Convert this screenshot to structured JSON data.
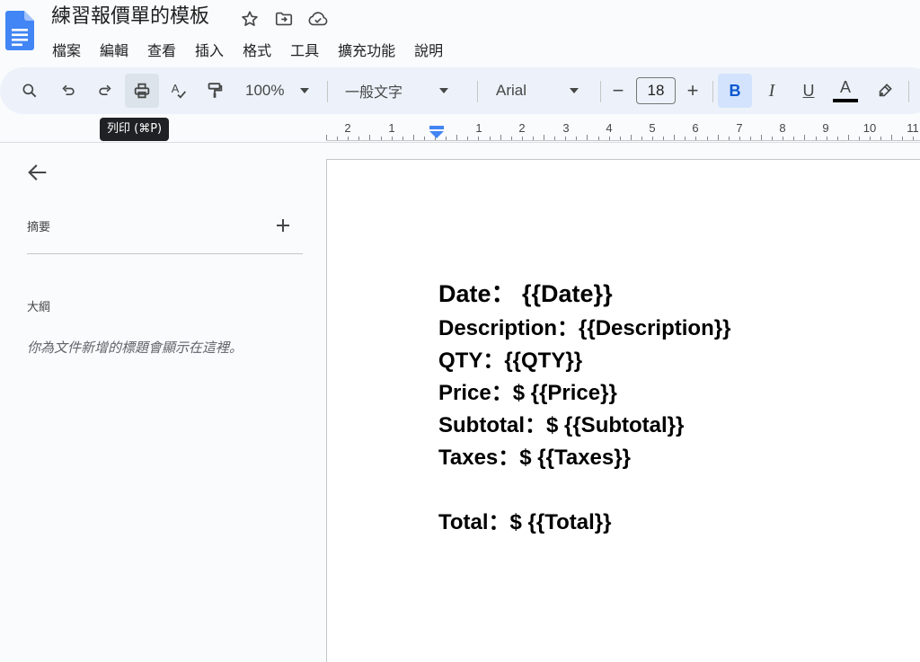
{
  "document": {
    "title": "練習報價單的模板"
  },
  "menu": {
    "items": [
      "檔案",
      "編輯",
      "查看",
      "插入",
      "格式",
      "工具",
      "擴充功能",
      "說明"
    ]
  },
  "toolbar": {
    "zoom": "100%",
    "paragraph_style": "一般文字",
    "font": "Arial",
    "font_size": "18",
    "bold_label": "B",
    "italic_label": "I",
    "underline_label": "U",
    "text_color_label": "A",
    "minus_label": "−",
    "plus_label": "+",
    "text_color": "#000000",
    "active_color": "#d3e3fd"
  },
  "tooltip": {
    "text": "列印 (⌘P)"
  },
  "ruler": {
    "labels": [
      "2",
      "1",
      "1",
      "2",
      "3",
      "4",
      "5",
      "6",
      "7",
      "8",
      "9",
      "10",
      "11"
    ]
  },
  "sidebar": {
    "summary_label": "摘要",
    "outline_label": "大綱",
    "outline_hint": "你為文件新增的標題會顯示在這裡。"
  },
  "content": {
    "lines": [
      "Date： {{Date}}",
      "Description：{{Description}}",
      "QTY：{{QTY}}",
      "Price：$ {{Price}}",
      "Subtotal：$ {{Subtotal}}",
      "Taxes：$ {{Taxes}}",
      "Total：$ {{Total}}"
    ]
  },
  "icons": {
    "app": "google-docs-icon",
    "star": "star-icon",
    "move": "move-to-folder-icon",
    "cloud": "cloud-saved-icon",
    "search": "search-menus-icon",
    "undo": "undo-icon",
    "redo": "redo-icon",
    "print": "print-icon",
    "spellcheck": "spellcheck-icon",
    "paint_format": "paint-format-icon",
    "highlight": "highlight-pen-icon",
    "back": "arrow-left-icon",
    "add": "plus-icon"
  },
  "colors": {
    "docs_blue": "#4285f4",
    "toolbar_bg": "#edf2fa",
    "page_bg": "#f9fbfd"
  }
}
